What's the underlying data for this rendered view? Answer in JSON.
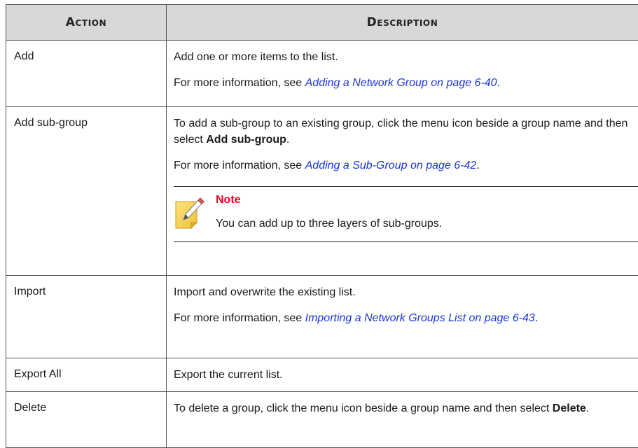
{
  "table": {
    "headers": {
      "action": "Action",
      "description": "Description"
    },
    "rows": [
      {
        "action": "Add",
        "desc1": "Add one or more items to the list.",
        "more_prefix": "For more information, see ",
        "link": "Adding a Network Group on page 6-40",
        "more_suffix": "."
      },
      {
        "action": "Add sub-group",
        "desc1_before": "To add a sub-group to an existing group, click the menu icon beside a group name and then select ",
        "desc1_bold": "Add sub-group",
        "desc1_after": ".",
        "more_prefix": "For more information, see ",
        "link": "Adding a Sub-Group on page 6-42",
        "more_suffix": ".",
        "note_title": "Note",
        "note_text": "You can add up to three layers of sub-groups."
      },
      {
        "action": "Import",
        "desc1": "Import and overwrite the existing list.",
        "more_prefix": "For more information, see ",
        "link": "Importing a Network Groups List on page 6-43",
        "more_suffix": "."
      },
      {
        "action": "Export All",
        "desc1": "Export the current list."
      },
      {
        "action": "Delete",
        "desc1_before": "To delete a group, click the menu icon beside a group name and then select ",
        "desc1_bold": "Delete",
        "desc1_after": "."
      }
    ]
  },
  "icons": {
    "note": "note-pencil-icon"
  },
  "colors": {
    "header_bg": "#d8d8d8",
    "link": "#1a35d8",
    "note_title": "#e8001c",
    "note_icon_fill": "#f7d35c"
  }
}
